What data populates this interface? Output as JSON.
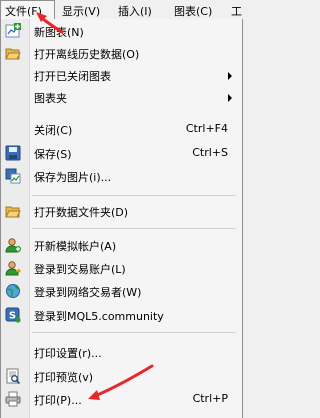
{
  "menubar": {
    "items": [
      {
        "label": "文件(F)"
      },
      {
        "label": "显示(V)"
      },
      {
        "label": "插入(I)"
      },
      {
        "label": "图表(C)"
      },
      {
        "label": "工"
      }
    ]
  },
  "file_menu": {
    "items": [
      {
        "label": "新图表(N)",
        "icon": "new-chart-icon"
      },
      {
        "label": "打开离线历史数据(O)",
        "icon": "open-folder-icon"
      },
      {
        "label": "打开已关闭图表",
        "has_submenu": true
      },
      {
        "label": "图表夹",
        "has_submenu": true
      },
      {
        "label": "关闭(C)",
        "shortcut": "Ctrl+F4"
      },
      {
        "label": "保存(S)",
        "shortcut": "Ctrl+S",
        "icon": "save-icon"
      },
      {
        "label": "保存为图片(i)...",
        "icon": "save-picture-icon"
      },
      {
        "label": "打开数据文件夹(D)",
        "icon": "open-folder-icon"
      },
      {
        "label": "开新模拟帐户(A)",
        "icon": "demo-account-icon"
      },
      {
        "label": "登录到交易账户(L)",
        "icon": "trade-login-icon"
      },
      {
        "label": "登录到网络交易者(W)",
        "icon": "web-trader-icon"
      },
      {
        "label": "登录到MQL5.community",
        "icon": "mql5-icon"
      },
      {
        "label": "打印设置(r)..."
      },
      {
        "label": "打印预览(v)",
        "icon": "print-preview-icon"
      },
      {
        "label": "打印(P)...",
        "shortcut": "Ctrl+P",
        "icon": "printer-icon"
      }
    ]
  },
  "colors": {
    "annotation_arrow": "#e8262c",
    "accent_green": "#2e9a2e",
    "accent_blue": "#2e66b8",
    "folder_yellow": "#e6b84a"
  }
}
